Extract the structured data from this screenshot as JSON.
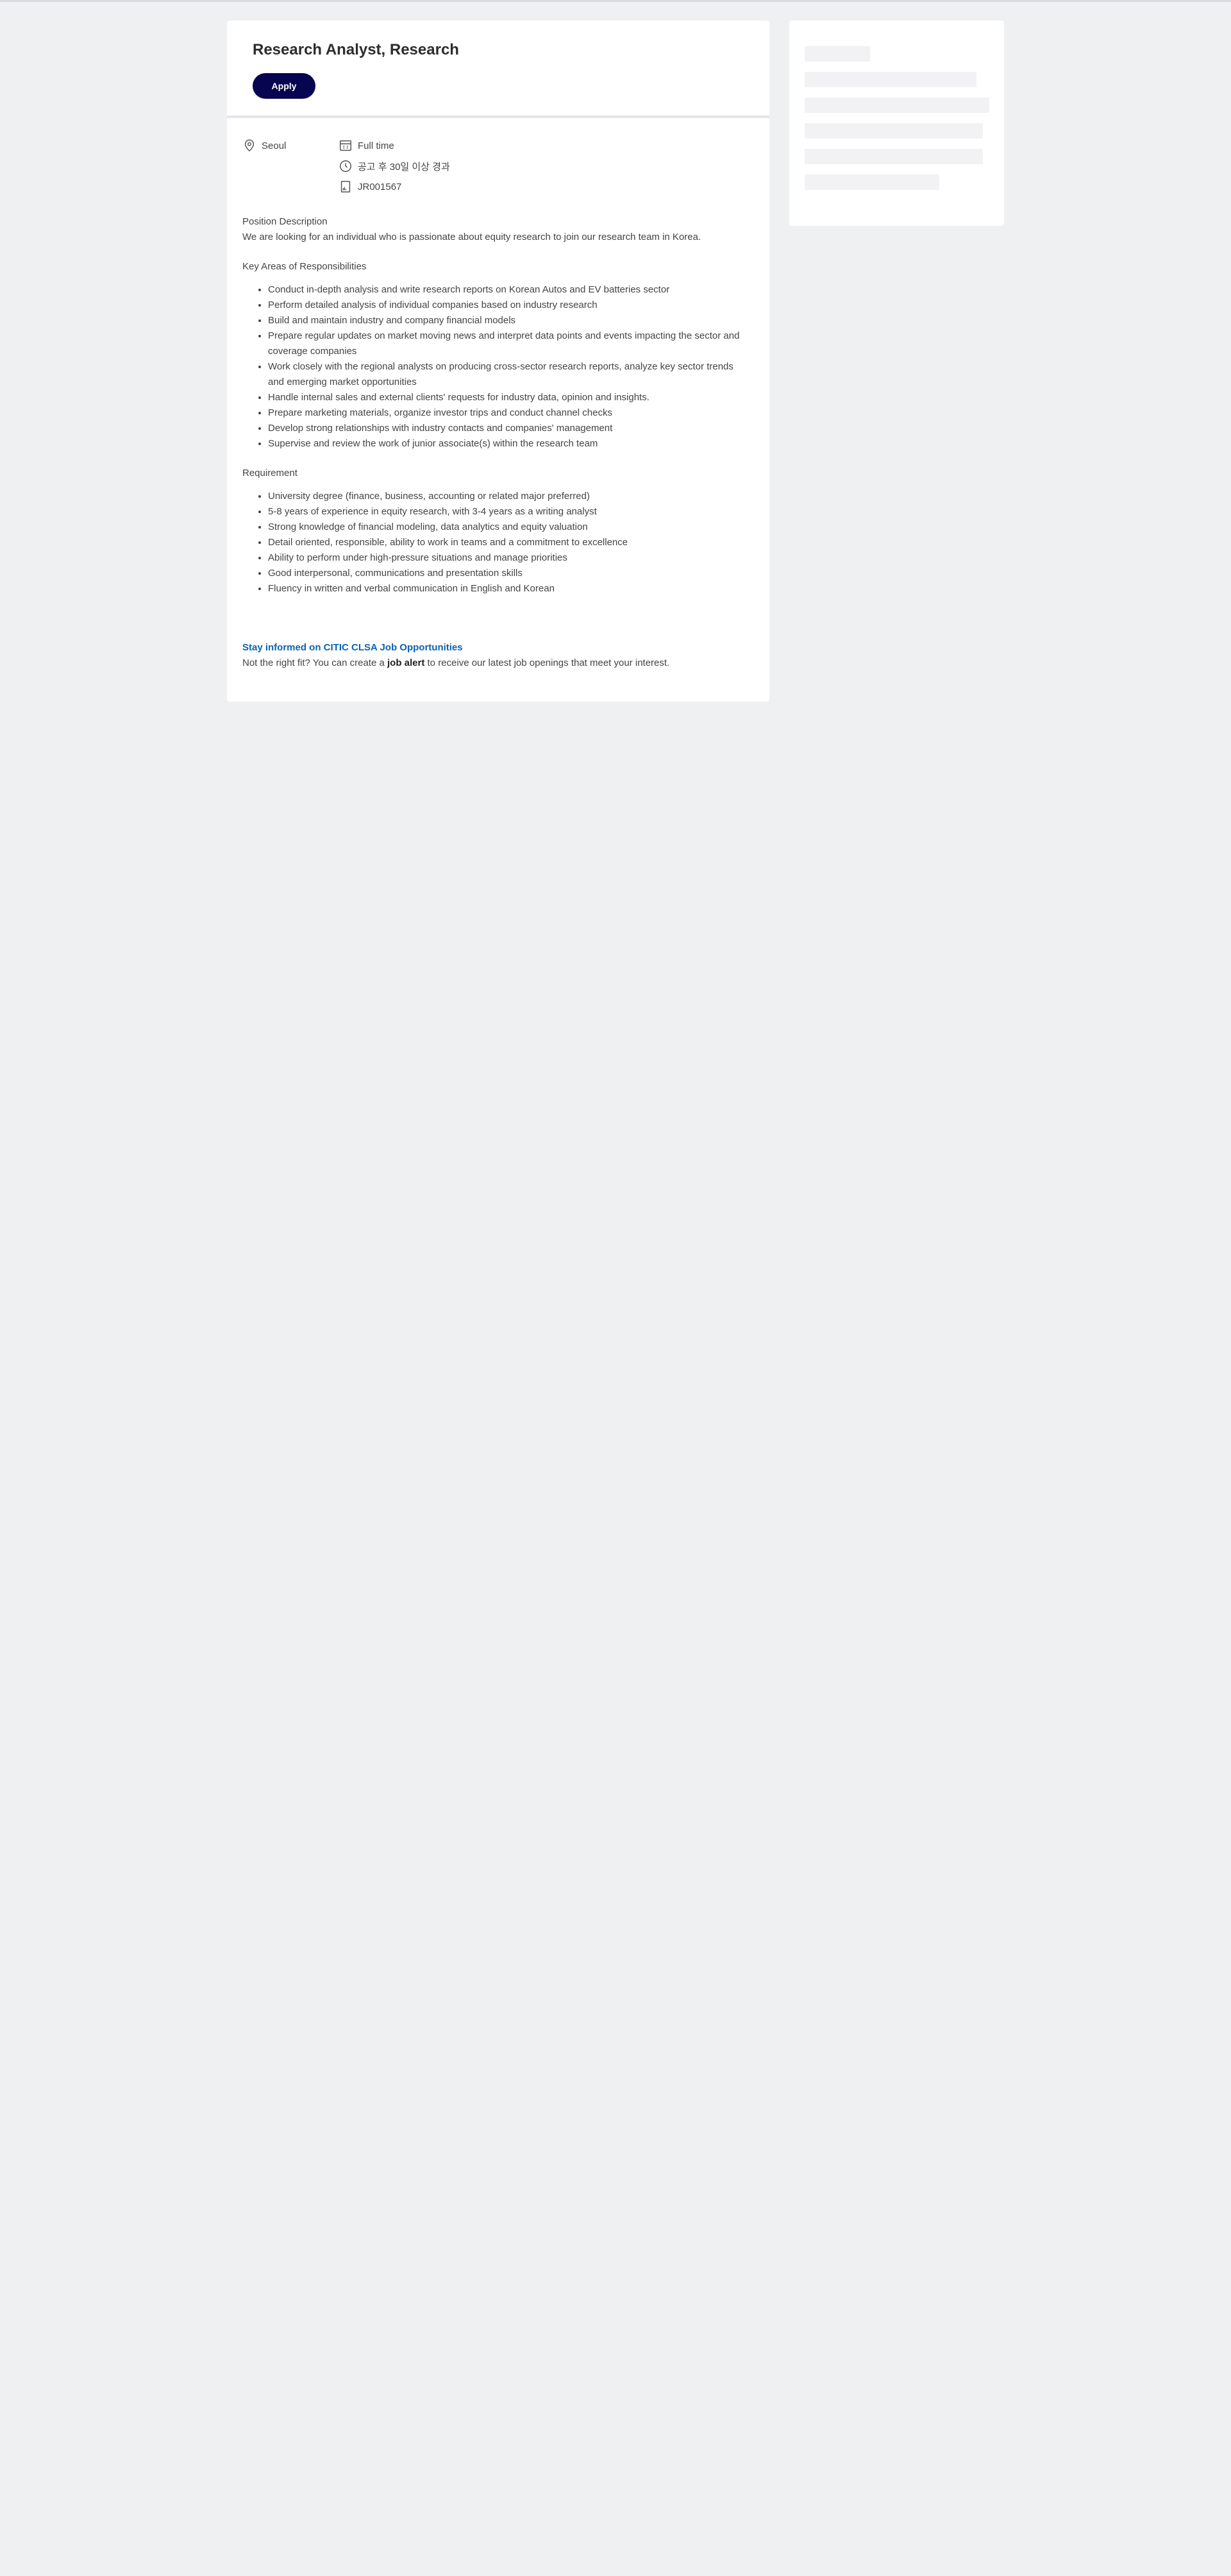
{
  "job": {
    "title": "Research Analyst, Research",
    "apply_label": "Apply",
    "location": "Seoul",
    "employment_type": "Full time",
    "posted": "공고 후 30일 이상 경과",
    "job_id": "JR001567"
  },
  "description": {
    "position_heading": "Position Description",
    "position_text": "We are looking for an individual who is passionate about equity research to join our research team in Korea.",
    "responsibilities_heading": "Key Areas of Responsibilities",
    "responsibilities": [
      "Conduct in-depth analysis and write research reports on Korean Autos and EV batteries sector",
      "Perform detailed analysis of individual companies based on industry research",
      "Build and maintain industry and company financial models",
      "Prepare regular updates on market moving news and interpret data points and events impacting the sector and coverage companies",
      "Work closely with the regional analysts on producing cross-sector research reports, analyze key sector trends and emerging market opportunities",
      "Handle internal sales and external clients' requests for industry data, opinion and insights.",
      "Prepare marketing materials, organize investor trips and conduct channel checks",
      "Develop strong relationships with industry contacts and companies' management",
      "Supervise and review the work of junior associate(s) within the research team"
    ],
    "requirement_heading": "Requirement",
    "requirements": [
      "University degree (finance, business, accounting or related major preferred)",
      "5-8 years of experience in equity research, with 3-4 years as a writing analyst",
      "Strong knowledge of financial modeling, data analytics and equity valuation",
      "Detail oriented, responsible, ability to work in teams and a commitment to excellence",
      "Ability to perform under high-pressure situations and manage priorities",
      "Good interpersonal, communications and presentation skills",
      "Fluency in written and verbal communication in English and Korean"
    ]
  },
  "job_alert": {
    "title": "Stay informed on CITIC CLSA Job Opportunities",
    "text_before": "Not the right fit? You can create a ",
    "link_text": "job alert",
    "text_after": " to receive our latest job openings that meet your interest."
  },
  "icons": {
    "location": "location-pin-icon",
    "employment_type": "building-icon",
    "posted": "clock-icon",
    "job_id": "document-icon"
  },
  "colors": {
    "apply_button": "#07054f",
    "alert_title": "#0b63b0",
    "page_background": "#eff0f2"
  }
}
